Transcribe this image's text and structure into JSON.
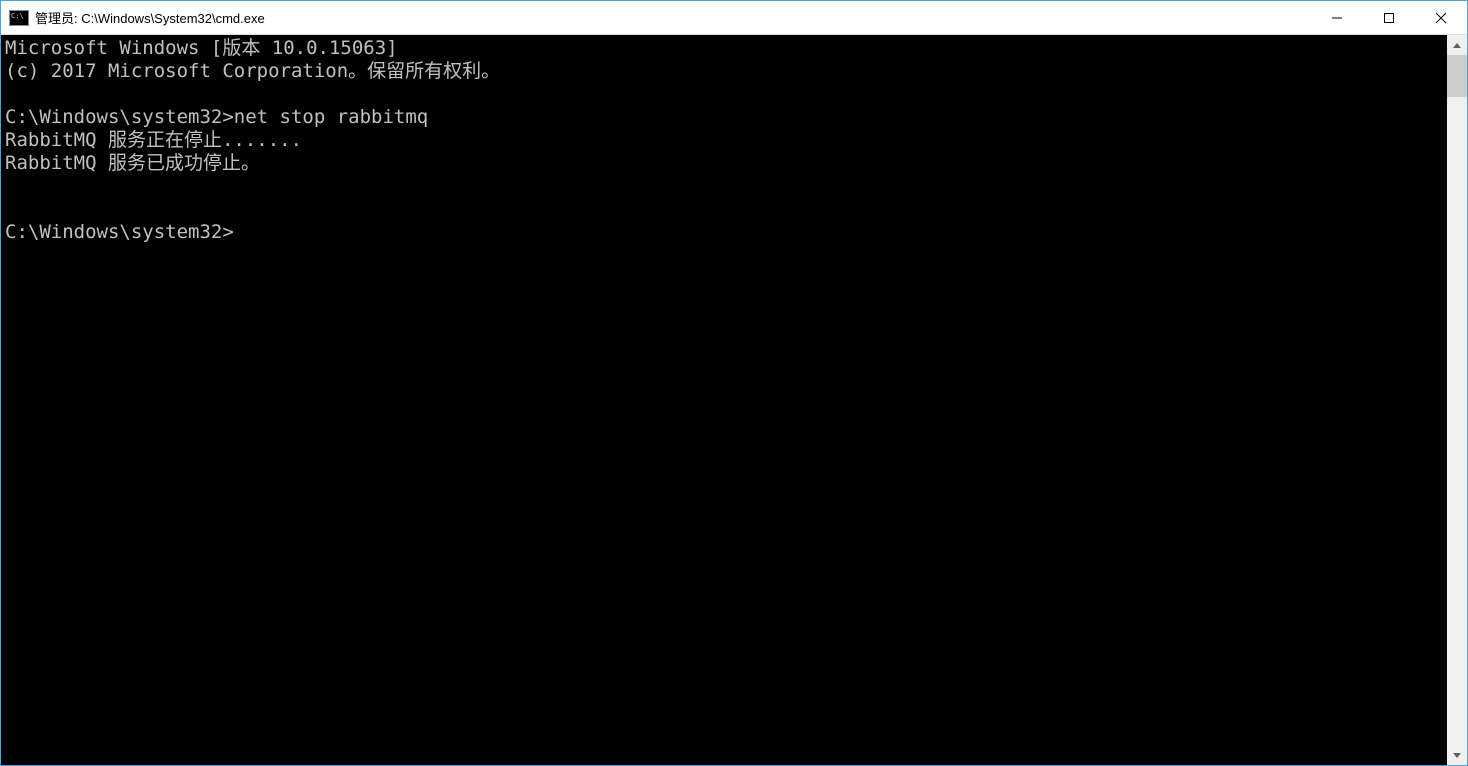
{
  "window": {
    "title": "管理员: C:\\Windows\\System32\\cmd.exe"
  },
  "terminal": {
    "lines": [
      "Microsoft Windows [版本 10.0.15063]",
      "(c) 2017 Microsoft Corporation。保留所有权利。",
      "",
      "C:\\Windows\\system32>net stop rabbitmq",
      "RabbitMQ 服务正在停止.......",
      "RabbitMQ 服务已成功停止。",
      "",
      "",
      "C:\\Windows\\system32>"
    ]
  }
}
